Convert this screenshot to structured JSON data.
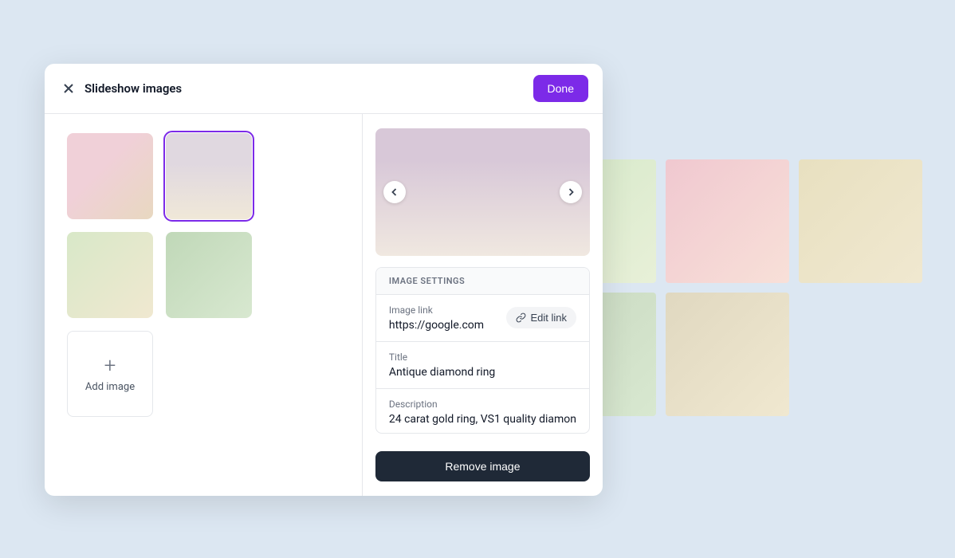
{
  "modal": {
    "title": "Slideshow images",
    "done_label": "Done",
    "add_image_label": "Add image"
  },
  "settings": {
    "header": "IMAGE SETTINGS",
    "link_label": "Image link",
    "link_value": "https://google.com",
    "edit_link_label": "Edit link",
    "title_label": "Title",
    "title_value": "Antique diamond ring",
    "description_label": "Description",
    "description_value": "24 carat gold ring, VS1 quality diamon",
    "remove_label": "Remove image"
  }
}
